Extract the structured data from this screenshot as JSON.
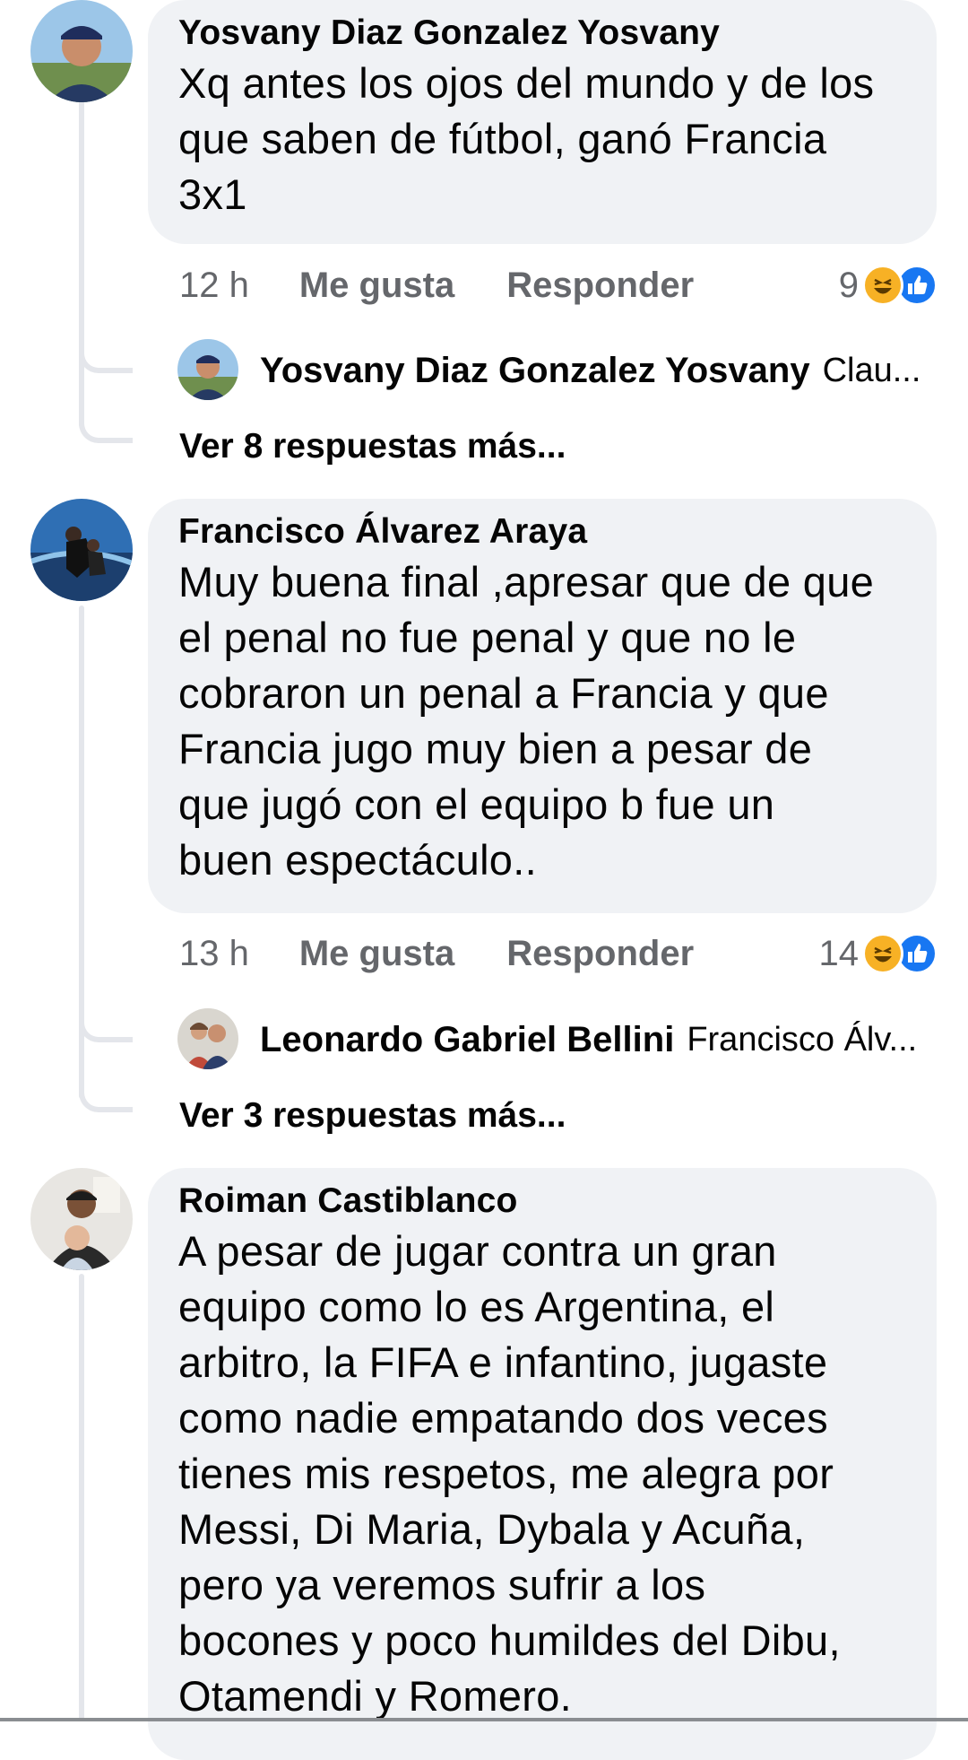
{
  "comments": [
    {
      "author": "Yosvany Diaz Gonzalez Yosvany",
      "lines": [
        "Xq antes los ojos del mundo y de los",
        "que saben de fútbol, ganó Francia",
        "3x1"
      ],
      "time": "12 h",
      "like_label": "Me gusta",
      "reply_label": "Responder",
      "reaction_count": "9",
      "reply_preview": {
        "author": "Yosvany Diaz Gonzalez Yosvany",
        "snippet": "Clau..."
      },
      "more_replies": "Ver 8 respuestas más..."
    },
    {
      "author": "Francisco Álvarez Araya",
      "lines": [
        "Muy buena final ,apresar que de que",
        "el penal no fue penal y que no le",
        "cobraron un penal a Francia y que",
        "Francia jugo muy bien a pesar de",
        "que jugó con el equipo b fue un",
        "buen espectáculo.."
      ],
      "time": "13 h",
      "like_label": "Me gusta",
      "reply_label": "Responder",
      "reaction_count": "14",
      "reply_preview": {
        "author": "Leonardo Gabriel Bellini",
        "snippet": "Francisco Álv..."
      },
      "more_replies": "Ver 3 respuestas más..."
    },
    {
      "author": "Roiman Castiblanco",
      "lines": [
        "A pesar de jugar contra un gran",
        "equipo como lo es Argentina, el",
        "arbitro, la FIFA e infantino, jugaste",
        "como nadie empatando dos veces",
        "tienes mis respetos, me alegra por",
        "Messi, Di Maria, Dybala y Acuña,",
        "pero ya veremos sufrir a los",
        "bocones y poco humildes del Dibu,",
        "Otamendi y Romero."
      ]
    }
  ],
  "icons": {
    "haha": "haha-reaction-icon",
    "like": "like-reaction-icon"
  },
  "colors": {
    "bubble": "#f0f2f5",
    "secondary_text": "#65676b",
    "like_blue": "#1877f2",
    "haha_yellow": "#f7b125"
  }
}
